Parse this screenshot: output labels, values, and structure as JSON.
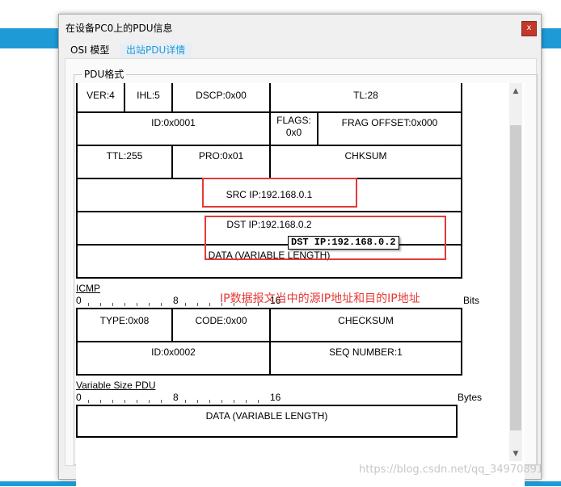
{
  "window": {
    "title": "在设备PC0上的PDU信息",
    "close_glyph": "x"
  },
  "tabs": [
    {
      "label": "OSI 模型"
    },
    {
      "label": "出站PDU详情"
    }
  ],
  "section_label": "PDU格式",
  "ip": {
    "row1": {
      "ver": "VER:4",
      "ihl": "IHL:5",
      "dscp": "DSCP:0x00",
      "tl": "TL:28"
    },
    "row2": {
      "id": "ID:0x0001",
      "flags": "FLAGS: 0x0",
      "frag": "FRAG OFFSET:0x000"
    },
    "row3": {
      "ttl": "TTL:255",
      "pro": "PRO:0x01",
      "chksum": "CHKSUM"
    },
    "src": "SRC IP:192.168.0.1",
    "dst": "DST IP:192.168.0.2",
    "data": "DATA (VARIABLE LENGTH)"
  },
  "tooltip": "DST IP:192.168.0.2",
  "annotation": "IP数据报文当中的源IP地址和目的IP地址",
  "icmp": {
    "title": "ICMP",
    "ruler": {
      "start": "0",
      "mid": "8",
      "end": "16",
      "unit": "Bits"
    },
    "type": "TYPE:0x08",
    "code": "CODE:0x00",
    "checksum": "CHECKSUM",
    "id": "ID:0x0002",
    "seq": "SEQ NUMBER:1"
  },
  "variable": {
    "title": "Variable Size PDU",
    "ruler": {
      "start": "0",
      "mid": "8",
      "end": "16",
      "unit": "Bytes"
    },
    "data": "DATA (VARIABLE LENGTH)"
  },
  "watermark": "https://blog.csdn.net/qq_34970891",
  "colors": {
    "accent": "#1e9bd7",
    "highlight": "#e53935"
  },
  "scroll": {
    "up_icon": "chevron-up-icon",
    "down_icon": "chevron-down-icon"
  }
}
